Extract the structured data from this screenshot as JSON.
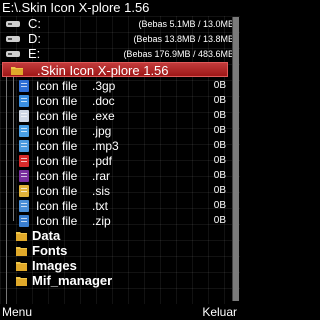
{
  "title": "E:\\.Skin Icon X-plore 1.56",
  "drives": [
    {
      "name": "C:",
      "info": "(Bebas 5.1MB / 13.0MB)",
      "icon": "drive-icon"
    },
    {
      "name": "D:",
      "info": "(Bebas 13.8MB / 13.8MB)",
      "icon": "drive-icon"
    },
    {
      "name": "E:",
      "info": "(Bebas 176.9MB / 483.6MB)",
      "icon": "drive-icon"
    }
  ],
  "selected_folder": {
    "label": ".Skin Icon X-plore 1.56",
    "icon": "folder-icon"
  },
  "files": [
    {
      "name": "Icon file",
      "ext": ".3gp",
      "size": "0B",
      "icon": "video-file-icon",
      "color": "#2f6fd6"
    },
    {
      "name": "Icon file",
      "ext": ".doc",
      "size": "0B",
      "icon": "document-file-icon",
      "color": "#3b8fe0"
    },
    {
      "name": "Icon file",
      "ext": ".exe",
      "size": "0B",
      "icon": "executable-file-icon",
      "color": "#cfd8e6"
    },
    {
      "name": "Icon file",
      "ext": ".jpg",
      "size": "0B",
      "icon": "image-file-icon",
      "color": "#4aa0e6"
    },
    {
      "name": "Icon file",
      "ext": ".mp3",
      "size": "0B",
      "icon": "audio-file-icon",
      "color": "#4c9be0"
    },
    {
      "name": "Icon file",
      "ext": ".pdf",
      "size": "0B",
      "icon": "pdf-file-icon",
      "color": "#d92b2b"
    },
    {
      "name": "Icon file",
      "ext": ".rar",
      "size": "0B",
      "icon": "archive-file-icon",
      "color": "#7a2f9e"
    },
    {
      "name": "Icon file",
      "ext": ".sis",
      "size": "0B",
      "icon": "install-file-icon",
      "color": "#e2b33a"
    },
    {
      "name": "Icon file",
      "ext": ".txt",
      "size": "0B",
      "icon": "text-file-icon",
      "color": "#4a8fd8"
    },
    {
      "name": "Icon file",
      "ext": ".zip",
      "size": "0B",
      "icon": "zip-file-icon",
      "color": "#3a7fd0"
    }
  ],
  "folders": [
    {
      "name": "Data",
      "icon": "folder-icon"
    },
    {
      "name": "Fonts",
      "icon": "folder-icon"
    },
    {
      "name": "Images",
      "icon": "folder-icon"
    },
    {
      "name": "Mif_manager",
      "icon": "folder-icon"
    }
  ],
  "softkeys": {
    "left": "Menu",
    "right": "Keluar"
  },
  "colors": {
    "selection": "#b02525",
    "folder": "#f0c64a",
    "background": "#000000"
  }
}
